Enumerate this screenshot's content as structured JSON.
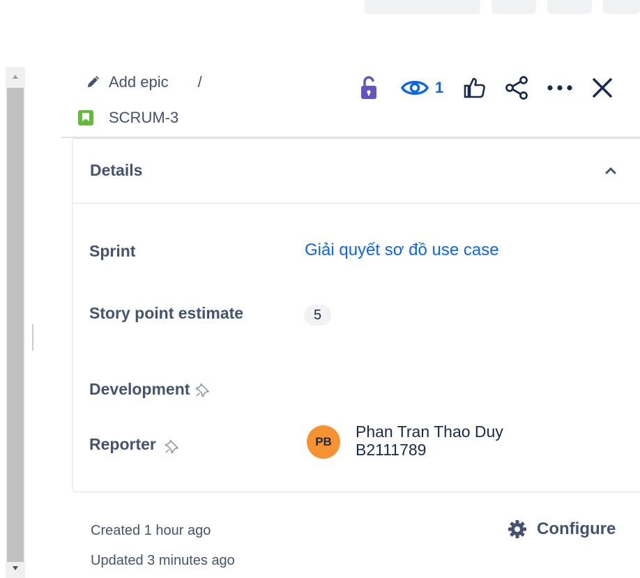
{
  "breadcrumb": {
    "epic_label": "Add epic",
    "separator": "/",
    "issue_key": "SCRUM-3"
  },
  "toolbar": {
    "watch_count": "1"
  },
  "details": {
    "title": "Details",
    "fields": {
      "sprint": {
        "label": "Sprint",
        "value": "Giải quyết sơ đồ use case"
      },
      "story_points": {
        "label": "Story point estimate",
        "value": "5"
      },
      "development": {
        "label": "Development"
      },
      "reporter": {
        "label": "Reporter",
        "initials": "PB",
        "name_line1": "Phan Tran Thao Duy",
        "name_line2": "B2111789"
      }
    }
  },
  "meta": {
    "created": "Created 1 hour ago",
    "updated": "Updated 3 minutes ago",
    "configure": "Configure"
  },
  "colors": {
    "link": "#0c66e4",
    "story": "#63ba3c",
    "avatar": "#f79232",
    "lock": "#6554c0"
  }
}
